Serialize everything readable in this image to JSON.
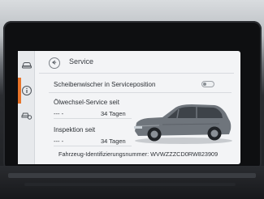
{
  "header": {
    "title": "Service"
  },
  "settings": {
    "wiper_label": "Scheibenwischer in Serviceposition",
    "wiper_toggle_on": false
  },
  "oil_service": {
    "label": "Ölwechsel-Service seit",
    "distance": "--- -",
    "days": "34 Tagen"
  },
  "inspection": {
    "label": "Inspektion seit",
    "distance": "--- -",
    "days": "34 Tagen"
  },
  "vehicle": {
    "vin_label": "Fahrzeug-Identifizierungsnummer:",
    "vin_value": "WVWZZZCD0RW823909"
  },
  "sidebar": {
    "icons": [
      "car-icon",
      "info-icon",
      "car-settings-icon"
    ]
  },
  "colors": {
    "accent": "#e8742a",
    "screen_bg": "#f3f4f6",
    "text": "#2d3136"
  }
}
